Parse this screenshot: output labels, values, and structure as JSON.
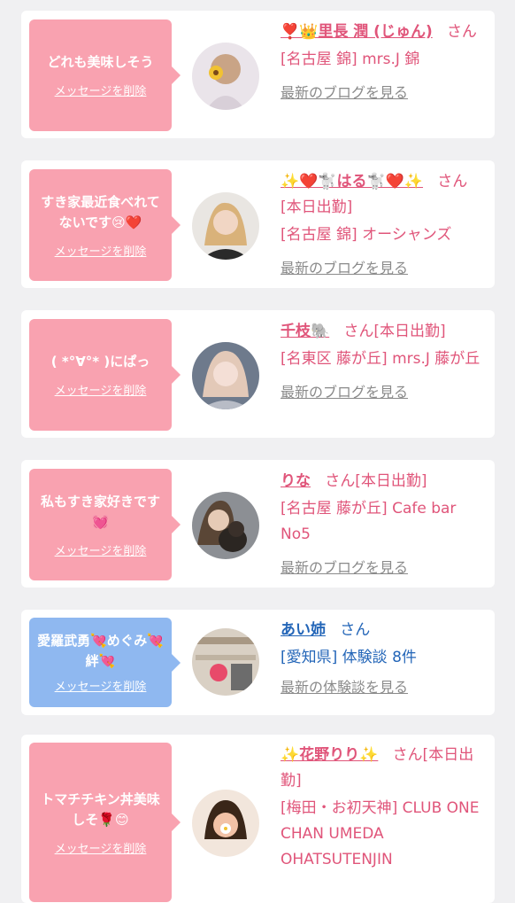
{
  "colors": {
    "background": "#f0f0f2",
    "card": "#ffffff",
    "bubble_pink": "#f9a2b0",
    "bubble_blue": "#8fb8f0",
    "pink_text": "#e0557a",
    "blue_text": "#2466b8",
    "gray_link": "#8a8a8a"
  },
  "cards": [
    {
      "message": "どれも美味しそう",
      "delete_label": "メッセージを削除",
      "name": "❣️👑里長 潤 (じゅん)",
      "suffix": "さん",
      "shop": "[名古屋 錦] mrs.J 錦",
      "link": "最新のブログを見る",
      "avatar_icon": "woman-portrait-sunflower"
    },
    {
      "message": "すき家最近食べれてないです😢❤️",
      "delete_label": "メッセージを削除",
      "name": "✨❤️🐩はる🐩❤️✨",
      "suffix": "さん[本日出勤]",
      "shop": "[名古屋 錦] オーシャンズ",
      "link": "最新のブログを見る",
      "avatar_icon": "woman-portrait-blonde"
    },
    {
      "message": "( *°∀°* )にぱっ",
      "delete_label": "メッセージを削除",
      "name": "千枝🐘",
      "suffix": "さん[本日出勤]",
      "shop": "[名東区 藤が丘] mrs.J 藤が丘",
      "link": "最新のブログを見る",
      "avatar_icon": "woman-portrait-light"
    },
    {
      "message": "私もすき家好きです💓",
      "delete_label": "メッセージを削除",
      "name": "りな",
      "suffix": "さん[本日出勤]",
      "shop": "[名古屋 藤が丘] Cafe bar No5",
      "link": "最新のブログを見る",
      "avatar_icon": "woman-with-dog"
    },
    {
      "message": "愛羅武勇💘めぐみ💘絆💘",
      "delete_label": "メッセージを削除",
      "name": "あい姉",
      "suffix": "さん",
      "shop": "[愛知県] 体験談 8件",
      "link": "最新の体験談を見る",
      "avatar_icon": "store-shelves-photo"
    },
    {
      "message": "トマチチキン丼美味しそ🌹😊",
      "delete_label": "メッセージを削除",
      "name": "✨花野りり✨",
      "suffix": "さん[本日出勤]",
      "shop": "[梅田・お初天神] CLUB ONE CHAN UMEDA OHATSUTENJIN",
      "link": "",
      "avatar_icon": "woman-portrait-flower-face"
    }
  ]
}
